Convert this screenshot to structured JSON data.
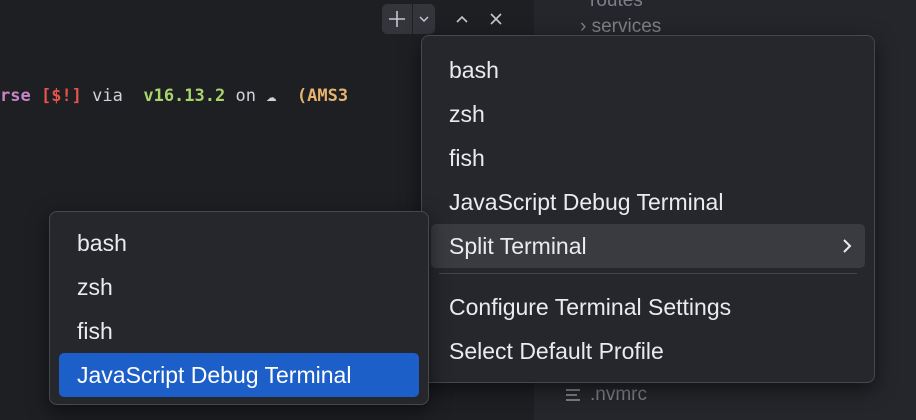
{
  "terminal": {
    "prompt": {
      "dir": "rse",
      "git_status": "[$!]",
      "via": " via ",
      "node_icon": "",
      "node_version": " v16.13.2",
      "on": " on ",
      "cloud_icon": "☁",
      "aws_region": "  (AMS3"
    }
  },
  "toolbar": {
    "new_terminal_icon": "plus-icon",
    "launch_profile_icon": "chevron-down-icon",
    "maximize_icon": "chevron-up-icon",
    "close_icon": "close-icon"
  },
  "explorer": {
    "partial_top": "routes",
    "services_label": "services",
    "nvmrc_label": ".nvmrc"
  },
  "main_menu": {
    "items": [
      {
        "label": "bash"
      },
      {
        "label": "zsh"
      },
      {
        "label": "fish"
      },
      {
        "label": "JavaScript Debug Terminal"
      },
      {
        "label": "Split Terminal"
      },
      {
        "label": "Configure Terminal Settings"
      },
      {
        "label": "Select Default Profile"
      }
    ]
  },
  "submenu": {
    "items": [
      {
        "label": "bash"
      },
      {
        "label": "zsh"
      },
      {
        "label": "fish"
      },
      {
        "label": "JavaScript Debug Terminal"
      }
    ]
  },
  "colors": {
    "selected_bg": "#1d5fc9",
    "hover_bg": "#393b41",
    "menu_bg": "#25272c"
  }
}
